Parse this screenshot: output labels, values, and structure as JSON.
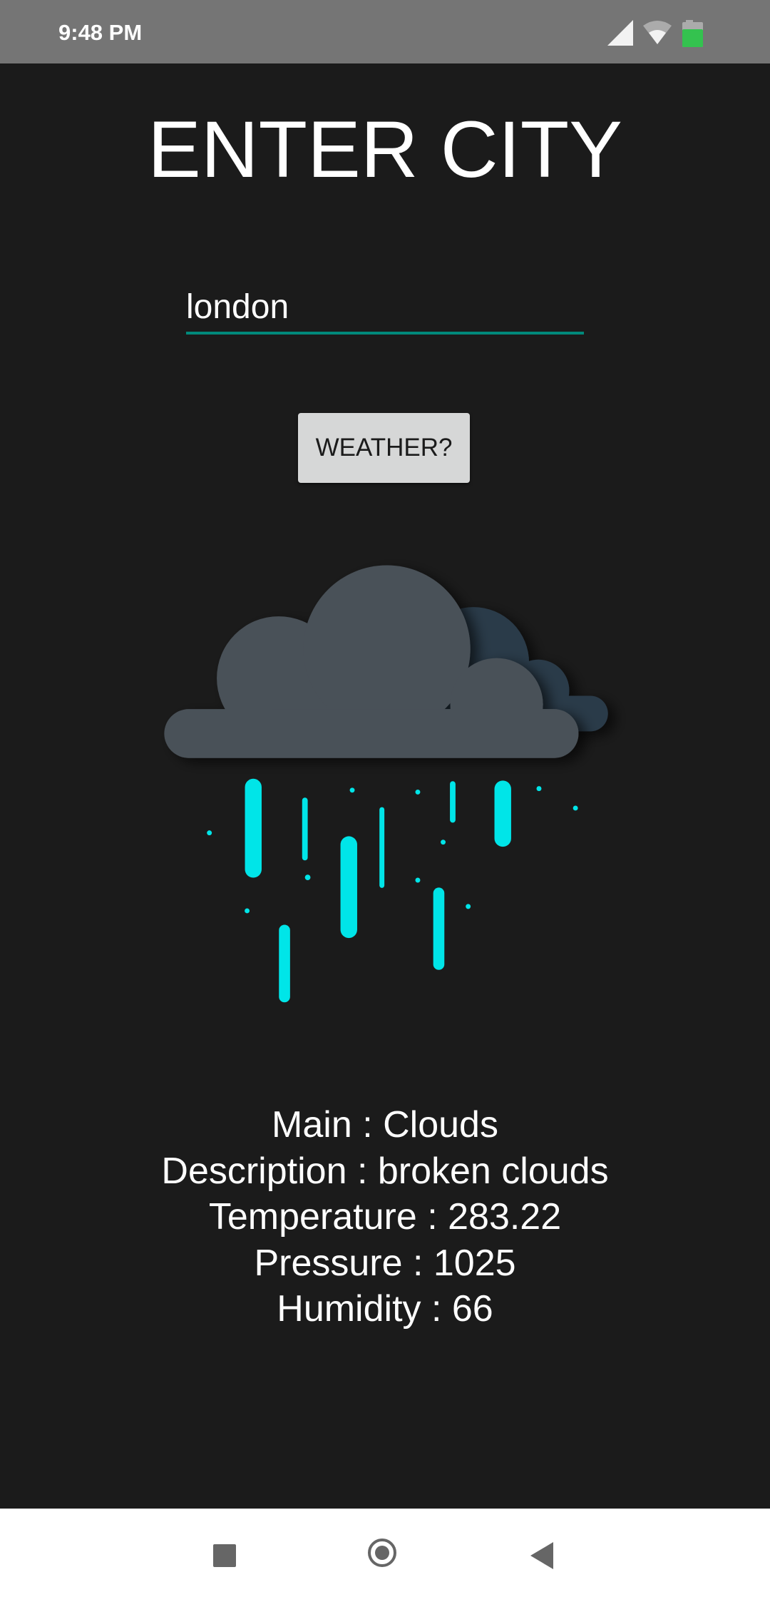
{
  "status_bar": {
    "time": "9:48 PM",
    "icons": [
      "signal-icon",
      "wifi-icon",
      "battery-icon"
    ],
    "battery_color": "#34c24f"
  },
  "title": "ENTER CITY",
  "city_input": {
    "value": "london",
    "underline_color": "#00897b"
  },
  "weather_button": {
    "label": "WEATHER?"
  },
  "illustration": {
    "icon": "rain-cloud-icon",
    "cloud_color": "#4a5158",
    "back_cloud_color": "#2b3a48",
    "rain_color": "#00e5e8"
  },
  "results": [
    "Main : Clouds",
    "Description : broken clouds",
    "Temperature : 283.22",
    "Pressure : 1025",
    "Humidity : 66"
  ],
  "nav_bar": {
    "icons": [
      "recents-icon",
      "home-icon",
      "back-icon"
    ]
  }
}
